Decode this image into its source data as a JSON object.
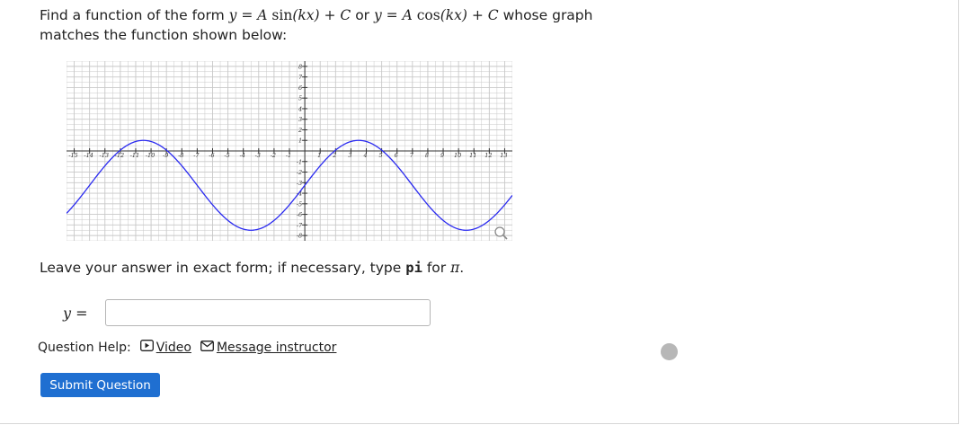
{
  "question": {
    "prefix": "Find a function of the form",
    "form1_lhs": "y",
    "form1_eq": " = ",
    "form1_rhs_A": "A",
    "form1_rhs_fn": " sin",
    "form1_rhs_arg": "(kx)",
    "form1_rhs_C": " + C",
    "or": " or ",
    "form2_lhs": "y",
    "form2_eq": " = ",
    "form2_rhs_A": "A",
    "form2_rhs_fn": " cos",
    "form2_rhs_arg": "(kx)",
    "form2_rhs_C": " + C",
    "suffix": " whose graph",
    "line2": "matches the function shown below:"
  },
  "graph": {
    "x_ticks": [
      "-15",
      "-14",
      "-13",
      "-12",
      "-11",
      "-10",
      "-9",
      "-8",
      "-7",
      "-6",
      "-5",
      "-4",
      "-3",
      "-2",
      "-1",
      "1",
      "2",
      "3",
      "4",
      "5",
      "6",
      "7",
      "8",
      "9",
      "10",
      "11",
      "12",
      "13"
    ],
    "y_ticks": [
      "8",
      "7",
      "6",
      "5",
      "4",
      "3",
      "2",
      "1",
      "-1",
      "-2",
      "-3",
      "-4",
      "-5",
      "-6",
      "-7",
      "-8"
    ],
    "curve_color": "#2a2af0",
    "grid_color": "#c8c8c8",
    "zoom_icon": "magnifier-icon"
  },
  "chart_data": {
    "type": "line",
    "xlim": [
      -15.5,
      13.5
    ],
    "ylim": [
      -8.5,
      8.5
    ],
    "grid": true,
    "series": [
      {
        "x": [
          -15.5,
          -10.5,
          -3.5,
          3.5,
          10.5,
          13.5
        ],
        "y": [
          -3.5,
          1,
          -7.5,
          1,
          -7.5,
          -5.5
        ]
      }
    ]
  },
  "instructions": {
    "before": "Leave your answer in exact form; if necessary, type ",
    "code": "pi",
    "after": " for ",
    "pi": "π",
    "end": "."
  },
  "answer": {
    "label": "y =",
    "value": "",
    "placeholder": ""
  },
  "help": {
    "label": "Question Help:",
    "video": "Video",
    "message": "Message instructor"
  },
  "submit": {
    "label": "Submit Question"
  }
}
